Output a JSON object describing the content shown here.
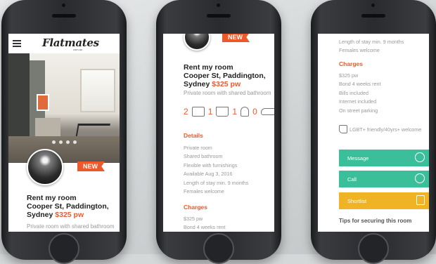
{
  "app": {
    "brand": "Flatmates",
    "brand_sub": "com.au"
  },
  "listing": {
    "badge": "NEW",
    "title_line1": "Rent my room",
    "title_line2": "Cooper St, Paddington,",
    "title_line3_prefix": "Sydney",
    "price": "$325 pw",
    "subtitle": "Private room with shared bathroom"
  },
  "features": {
    "bedrooms": "2",
    "bathrooms": "1",
    "flatmates": "1",
    "parking": "0"
  },
  "details": {
    "heading": "Details",
    "items": [
      "Private room",
      "Shared bathroom",
      "Flexible with furnishings",
      "Available Aug 3, 2016",
      "Length of stay min. 9 months",
      "Females welcome"
    ]
  },
  "charges": {
    "heading": "Charges",
    "items": [
      "$325 pw",
      "Bond 4 weeks rent",
      "Bills included",
      "Internet included",
      "On street parking"
    ]
  },
  "phone2_charges_visible": [
    "$325 pw",
    "Bond 4 weeks rent"
  ],
  "phone3_top": [
    "Length of stay min. 9 months",
    "Females welcome"
  ],
  "lgbt": "LGBT+ friendly/40yrs+ welcome",
  "actions": {
    "message": "Message",
    "call": "Call",
    "shortlist": "Shortlist",
    "message_color": "#3bbf9a",
    "call_color": "#3bbf9a",
    "shortlist_color": "#f0b323"
  },
  "tips": "Tips for securing this room",
  "accent": "#ec5a2b"
}
